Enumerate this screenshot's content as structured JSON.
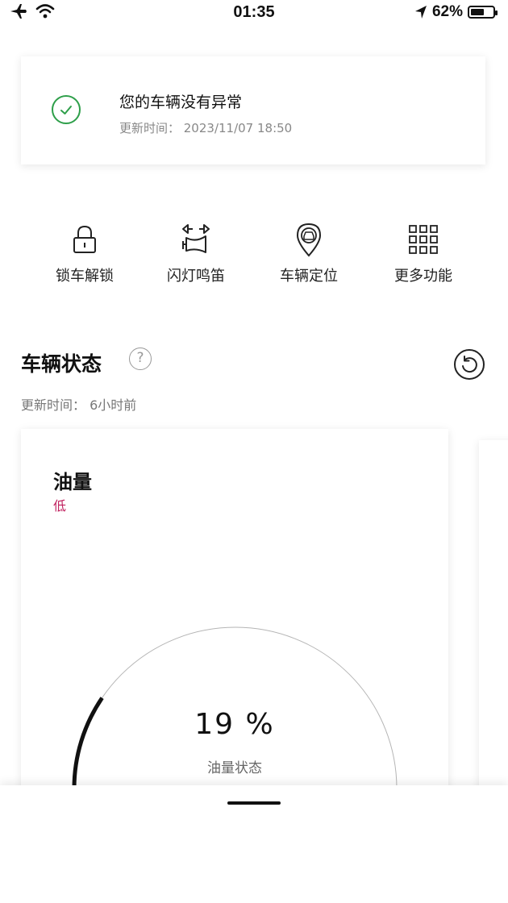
{
  "status_bar": {
    "time": "01:35",
    "battery_text": "62%",
    "battery_level": 0.62
  },
  "alert": {
    "title": "您的车辆没有异常",
    "updated": "更新时间： 2023/11/07 18:50",
    "icon": "check-circle-icon",
    "icon_color": "#2e9f4a"
  },
  "actions": [
    {
      "label": "锁车解锁",
      "icon": "lock-icon"
    },
    {
      "label": "闪灯鸣笛",
      "icon": "flash-horn-icon"
    },
    {
      "label": "车辆定位",
      "icon": "car-location-icon"
    },
    {
      "label": "更多功能",
      "icon": "grid-icon"
    }
  ],
  "vehicle_status": {
    "title": "车辆状态",
    "help": "?",
    "updated": "更新时间： 6小时前"
  },
  "fuel": {
    "title": "油量",
    "level_text": "低",
    "level_color": "#c0205e",
    "percent_text": "19 %",
    "percent_value": 19,
    "label": "油量状态"
  }
}
